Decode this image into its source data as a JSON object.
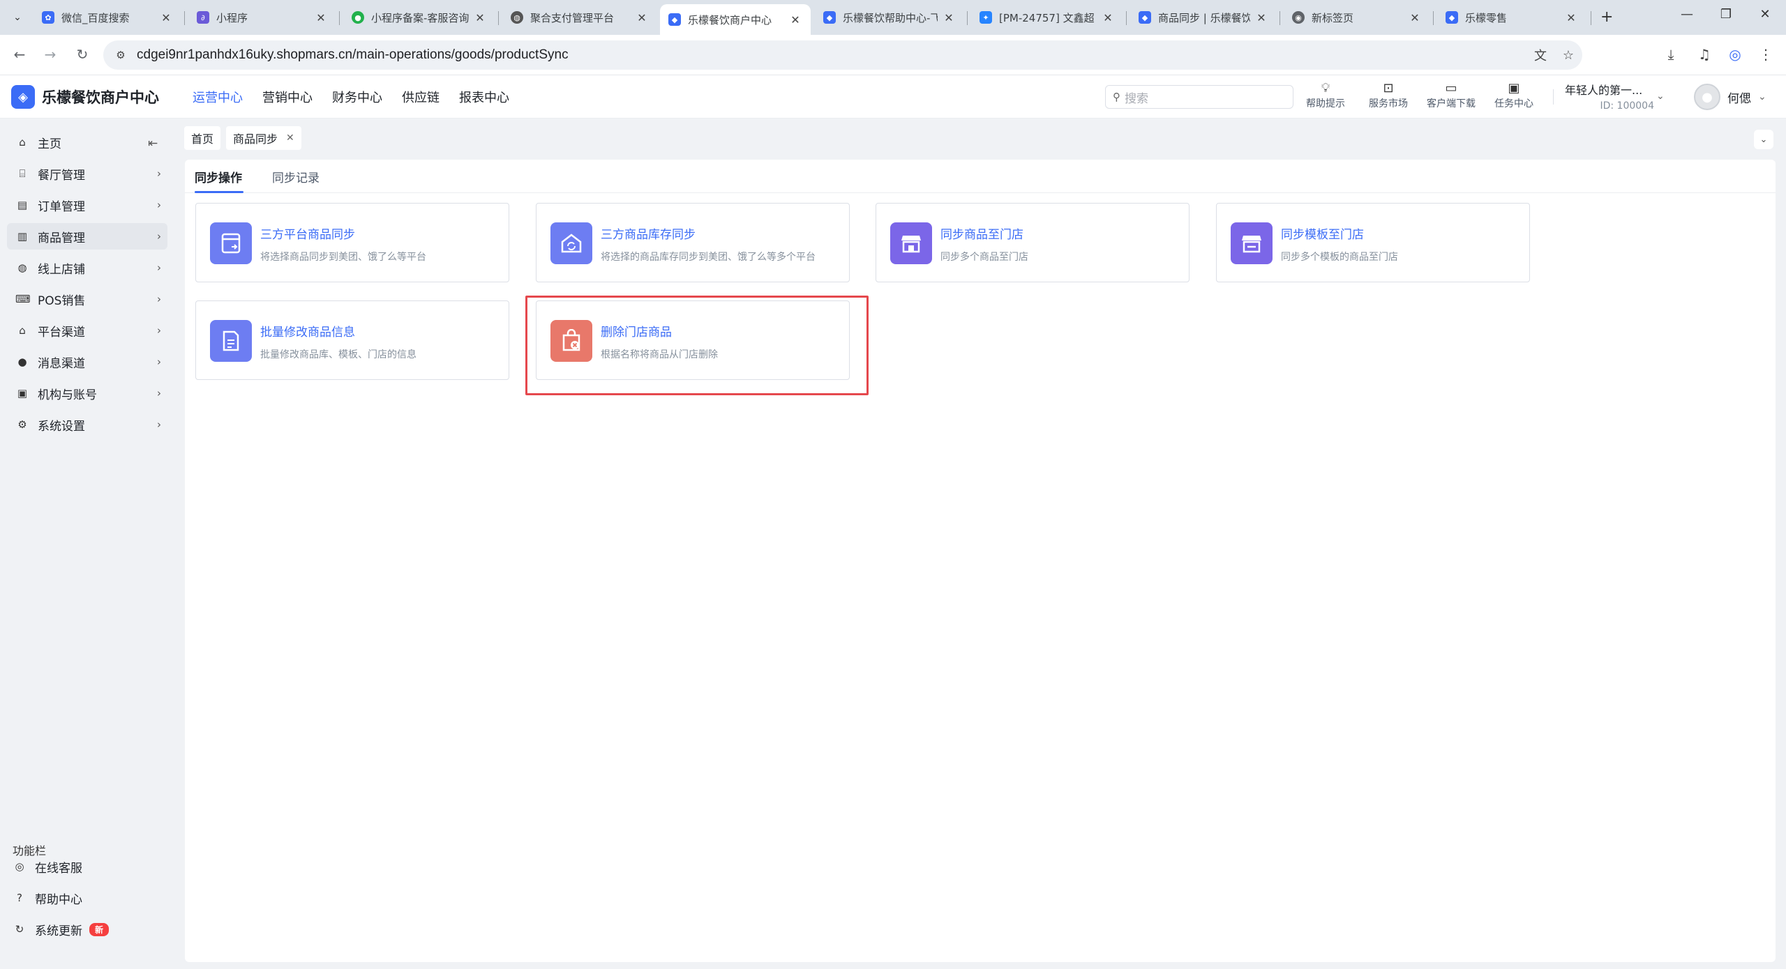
{
  "colors": {
    "accent": "#3b6cf6",
    "highlight": "#e5484d",
    "badge": "#f53f3f"
  },
  "browser": {
    "tabs": [
      {
        "title": "微信_百度搜索",
        "icon": "baidu-icon"
      },
      {
        "title": "小程序",
        "icon": "link-icon"
      },
      {
        "title": "小程序备案-客服咨询",
        "icon": "wechat-icon"
      },
      {
        "title": "聚合支付管理平台",
        "icon": "globe-icon"
      },
      {
        "title": "乐檬餐饮商户中心",
        "icon": "lemeng-icon"
      },
      {
        "title": "乐檬餐饮帮助中心-飞",
        "icon": "lemeng-icon"
      },
      {
        "title": "[PM-24757] 文鑫超",
        "icon": "jira-icon"
      },
      {
        "title": "商品同步 | 乐檬餐饮",
        "icon": "lemeng-icon"
      },
      {
        "title": "新标签页",
        "icon": "chrome-icon"
      },
      {
        "title": "乐檬零售",
        "icon": "lemeng-icon"
      }
    ],
    "url": "cdgei9nr1panhdx16uky.shopmars.cn/main-operations/goods/productSync"
  },
  "app": {
    "brand": "乐檬餐饮商户中心",
    "nav": [
      "运营中心",
      "营销中心",
      "财务中心",
      "供应链",
      "报表中心"
    ],
    "search_placeholder": "搜索",
    "tools": [
      "帮助提示",
      "服务市场",
      "客户端下载",
      "任务中心"
    ],
    "account_name": "年轻人的第一...",
    "account_id": "ID: 100004",
    "user_name": "何偲"
  },
  "sidebar": {
    "items": [
      {
        "label": "主页",
        "icon": "home-icon"
      },
      {
        "label": "餐厅管理",
        "icon": "store-icon"
      },
      {
        "label": "订单管理",
        "icon": "order-icon"
      },
      {
        "label": "商品管理",
        "icon": "goods-icon"
      },
      {
        "label": "线上店铺",
        "icon": "globe-icon"
      },
      {
        "label": "POS销售",
        "icon": "pos-icon"
      },
      {
        "label": "平台渠道",
        "icon": "bank-icon"
      },
      {
        "label": "消息渠道",
        "icon": "message-icon"
      },
      {
        "label": "机构与账号",
        "icon": "account-icon"
      },
      {
        "label": "系统设置",
        "icon": "gear-icon"
      }
    ],
    "func_title": "功能栏",
    "func_items": [
      {
        "label": "在线客服",
        "icon": "headset-icon"
      },
      {
        "label": "帮助中心",
        "icon": "help-icon"
      },
      {
        "label": "系统更新",
        "icon": "refresh-icon",
        "badge": "新"
      }
    ]
  },
  "breadcrumb": {
    "home": "首页",
    "current": "商品同步"
  },
  "subtabs": [
    "同步操作",
    "同步记录"
  ],
  "cards": [
    {
      "title": "三方平台商品同步",
      "desc": "将选择商品同步到美团、饿了么等平台",
      "icon": "platform-sync-icon",
      "color": "#6d7df2"
    },
    {
      "title": "三方商品库存同步",
      "desc": "将选择的商品库存同步到美团、饿了么等多个平台",
      "icon": "stock-sync-icon",
      "color": "#6d7df2"
    },
    {
      "title": "同步商品至门店",
      "desc": "同步多个商品至门店",
      "icon": "store-sync-icon",
      "color": "#7b66e8"
    },
    {
      "title": "同步模板至门店",
      "desc": "同步多个模板的商品至门店",
      "icon": "template-sync-icon",
      "color": "#7b66e8"
    },
    {
      "title": "批量修改商品信息",
      "desc": "批量修改商品库、模板、门店的信息",
      "icon": "batch-edit-icon",
      "color": "#6d7df2"
    },
    {
      "title": "删除门店商品",
      "desc": "根据名称将商品从门店删除",
      "icon": "delete-goods-icon",
      "color": "#e8786a"
    }
  ]
}
